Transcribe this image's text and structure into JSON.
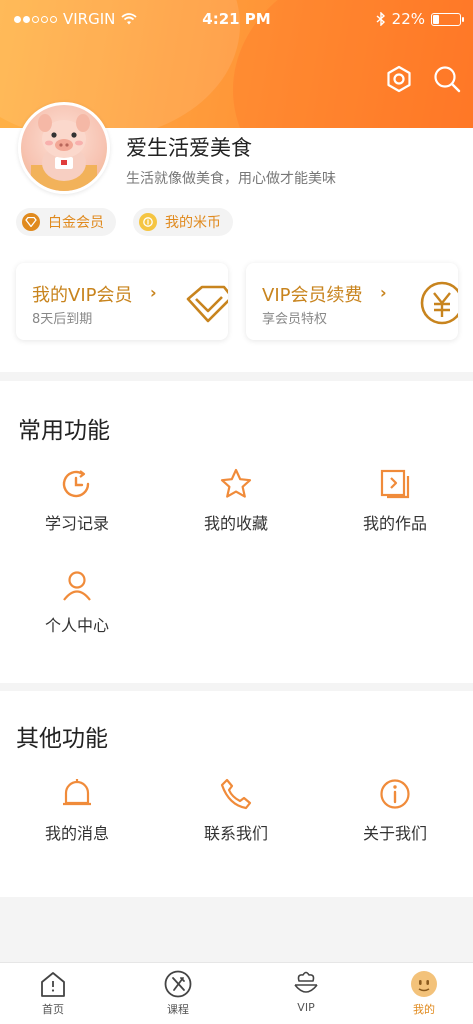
{
  "status_bar": {
    "carrier": "VIRGIN",
    "time": "4:21 PM",
    "battery": "22%",
    "battery_level": 0.22
  },
  "header": {
    "icons": [
      "settings-hexagon-icon",
      "search-icon"
    ]
  },
  "profile": {
    "nickname": "爱生活爱美食",
    "signature": "生活就像做美食，用心做才能美味",
    "badges": [
      {
        "label": "白金会员",
        "icon": "diamond-icon"
      },
      {
        "label": "我的米币",
        "icon": "coin-icon"
      }
    ]
  },
  "vip_cards": [
    {
      "title": "我的VIP会员",
      "subtitle": "8天后到期",
      "icon": "vip-diamond-icon"
    },
    {
      "title": "VIP会员续费",
      "subtitle": "享会员特权",
      "icon": "yuan-coin-icon"
    }
  ],
  "common_functions": {
    "title": "常用功能",
    "items": [
      {
        "label": "学习记录",
        "icon": "clock-history-icon"
      },
      {
        "label": "我的收藏",
        "icon": "star-icon"
      },
      {
        "label": "我的作品",
        "icon": "works-icon"
      },
      {
        "label": "个人中心",
        "icon": "user-icon"
      }
    ]
  },
  "other_functions": {
    "title": "其他功能",
    "items": [
      {
        "label": "我的消息",
        "icon": "bell-icon"
      },
      {
        "label": "联系我们",
        "icon": "phone-icon"
      },
      {
        "label": "关于我们",
        "icon": "info-icon"
      }
    ]
  },
  "tabbar": {
    "active": 3,
    "items": [
      {
        "label": "首页",
        "icon": "home-icon"
      },
      {
        "label": "课程",
        "icon": "utensils-icon"
      },
      {
        "label": "VIP",
        "icon": "vip-chef-icon"
      },
      {
        "label": "我的",
        "icon": "face-icon"
      }
    ]
  },
  "colors": {
    "accent": "#e08a1e",
    "icon": "#f08b3a",
    "header_start": "#ffb347",
    "header_end": "#ff7e2a"
  }
}
